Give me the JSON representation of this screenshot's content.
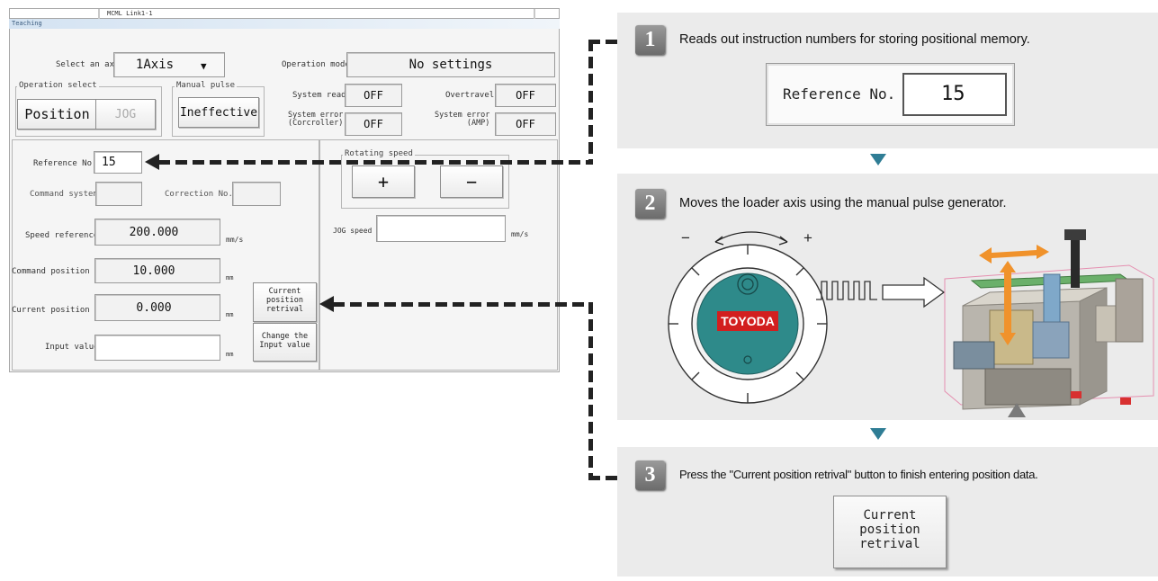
{
  "window": {
    "title": "MCML Link1-1",
    "tab": "Teaching"
  },
  "axis": {
    "label": "Select an axis",
    "value": "1Axis"
  },
  "operation_mode": {
    "label": "Operation mode",
    "value": "No settings"
  },
  "operation_select": {
    "label": "Operation select",
    "position": "Position",
    "jog": "JOG"
  },
  "manual_pulse": {
    "label": "Manual pulse",
    "value": "Ineffective"
  },
  "status": {
    "system_ready": {
      "label": "System ready",
      "value": "OFF"
    },
    "overtravel": {
      "label": "Overtravel",
      "value": "OFF"
    },
    "system_error_controller": {
      "line1": "System error",
      "line2": "(Corcroller)",
      "value": "OFF"
    },
    "system_error_amp": {
      "line1": "System error",
      "line2": "(AMP)",
      "value": "OFF"
    }
  },
  "reference_no": {
    "label": "Reference No.",
    "value": "15"
  },
  "command_system": {
    "label": "Command system",
    "value": ""
  },
  "correction_no": {
    "label": "Correction No.",
    "value": ""
  },
  "speed_reference": {
    "label": "Speed reference",
    "value": "200.000",
    "unit": "mm/s"
  },
  "command_position": {
    "label": "Command position",
    "value": "10.000",
    "unit": "mm"
  },
  "current_position": {
    "label": "Current position",
    "value": "0.000",
    "unit": "mm"
  },
  "input_value": {
    "label": "Input value",
    "value": "",
    "unit": "mm"
  },
  "current_position_retrival_button": {
    "line1": "Current",
    "line2": "position",
    "line3": "retrival"
  },
  "change_input_button": {
    "line1": "Change the",
    "line2": "Input value"
  },
  "rotating_speed": {
    "label": "Rotating speed",
    "plus": "+",
    "minus": "−"
  },
  "jog_speed": {
    "label": "JOG speed",
    "value": "",
    "unit": "mm/s"
  },
  "steps": [
    {
      "number": "1",
      "text": "Reads out instruction numbers for storing positional memory."
    },
    {
      "number": "2",
      "text": "Moves the loader axis using the manual pulse generator."
    },
    {
      "number": "3",
      "text": "Press the \"Current position retrival\" button to finish entering position data."
    }
  ],
  "callout_reference": {
    "label": "Reference No.",
    "value": "15"
  },
  "pulse_generator": {
    "brand": "TOYODA",
    "minus": "−",
    "plus": "+"
  },
  "accent_colors": {
    "arrow_teal": "#2f7d95",
    "motion_orange": "#f0922b",
    "dial_teal": "#2e8a8a",
    "brand_red": "#d21f1f"
  }
}
